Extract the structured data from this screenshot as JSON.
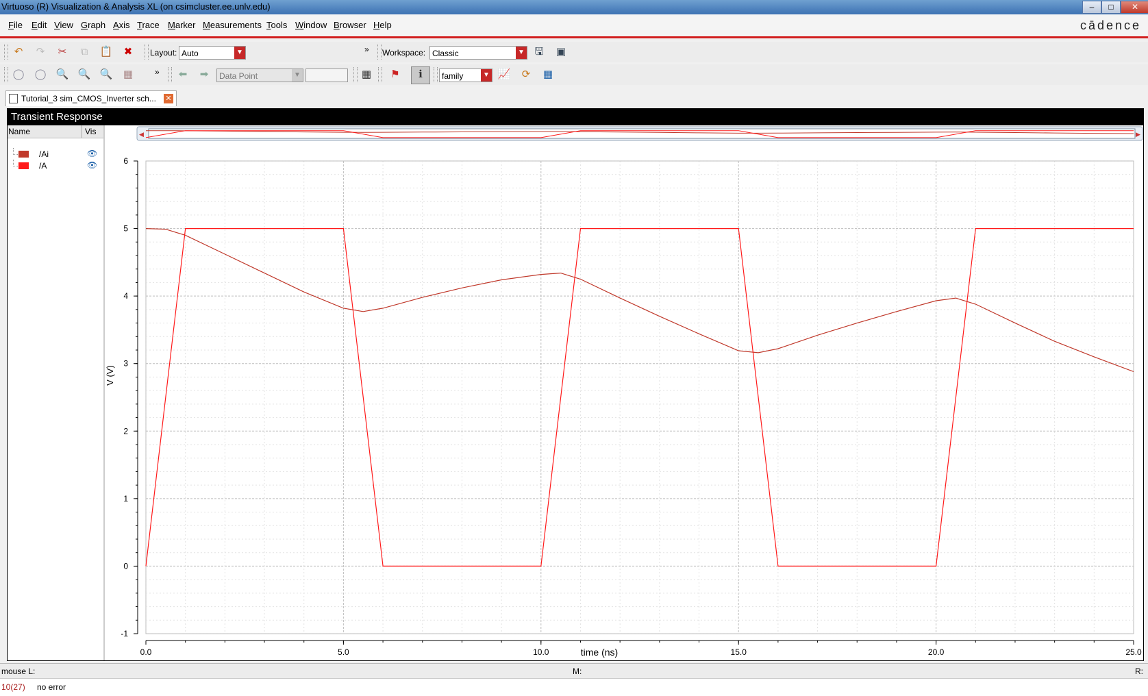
{
  "window": {
    "title": "Virtuoso (R) Visualization & Analysis XL (on csimcluster.ee.unlv.edu)",
    "brand": "cādence"
  },
  "menu": [
    "File",
    "Edit",
    "View",
    "Graph",
    "Axis",
    "Trace",
    "Marker",
    "Measurements",
    "Tools",
    "Window",
    "Browser",
    "Help"
  ],
  "toolbar": {
    "layout_label": "Layout:",
    "layout_value": "Auto",
    "workspace_label": "Workspace:",
    "workspace_value": "Classic",
    "data_point_value": "Data Point",
    "family_value": "family",
    "more": "»"
  },
  "tab": {
    "label": "Tutorial_3 sim_CMOS_Inverter sch..."
  },
  "graph": {
    "title": "Transient Response",
    "legend_header_name": "Name",
    "legend_header_vis": "Vis"
  },
  "status": {
    "mouse_left": "mouse L:",
    "mouse_mid": "M:",
    "mouse_right": "R:",
    "counter": "10(27)",
    "message": "no error"
  },
  "chart_data": {
    "type": "line",
    "title": "Transient Response",
    "xlabel": "time (ns)",
    "ylabel": "V (V)",
    "xlim": [
      0,
      25
    ],
    "ylim": [
      -1,
      6
    ],
    "x_ticks": [
      "0.0",
      "5.0",
      "10.0",
      "15.0",
      "20.0",
      "25.0"
    ],
    "y_ticks": [
      "-1",
      "0",
      "1",
      "2",
      "3",
      "4",
      "5",
      "6"
    ],
    "grid": true,
    "legend": "left-panel",
    "series": [
      {
        "name": "/Ai",
        "color": "#c0392b",
        "x": [
          0,
          0.5,
          1.0,
          2.0,
          3.0,
          4.0,
          5.0,
          5.5,
          6.0,
          7.0,
          8.0,
          9.0,
          10.0,
          10.5,
          11.0,
          12.0,
          13.0,
          14.0,
          15.0,
          15.5,
          16.0,
          17.0,
          18.0,
          19.0,
          20.0,
          20.5,
          21.0,
          22.0,
          23.0,
          24.0,
          25.0
        ],
        "y": [
          5.0,
          4.99,
          4.9,
          4.62,
          4.34,
          4.06,
          3.82,
          3.77,
          3.82,
          3.98,
          4.12,
          4.24,
          4.32,
          4.34,
          4.25,
          3.97,
          3.7,
          3.44,
          3.19,
          3.16,
          3.22,
          3.42,
          3.6,
          3.77,
          3.93,
          3.97,
          3.88,
          3.6,
          3.33,
          3.1,
          2.88
        ]
      },
      {
        "name": "/A",
        "color": "#ff1a1a",
        "x": [
          0,
          1,
          5,
          6,
          10,
          11,
          15,
          16,
          20,
          21,
          25
        ],
        "y": [
          0,
          5,
          5,
          0,
          0,
          5,
          5,
          0,
          0,
          5,
          5
        ]
      }
    ]
  }
}
